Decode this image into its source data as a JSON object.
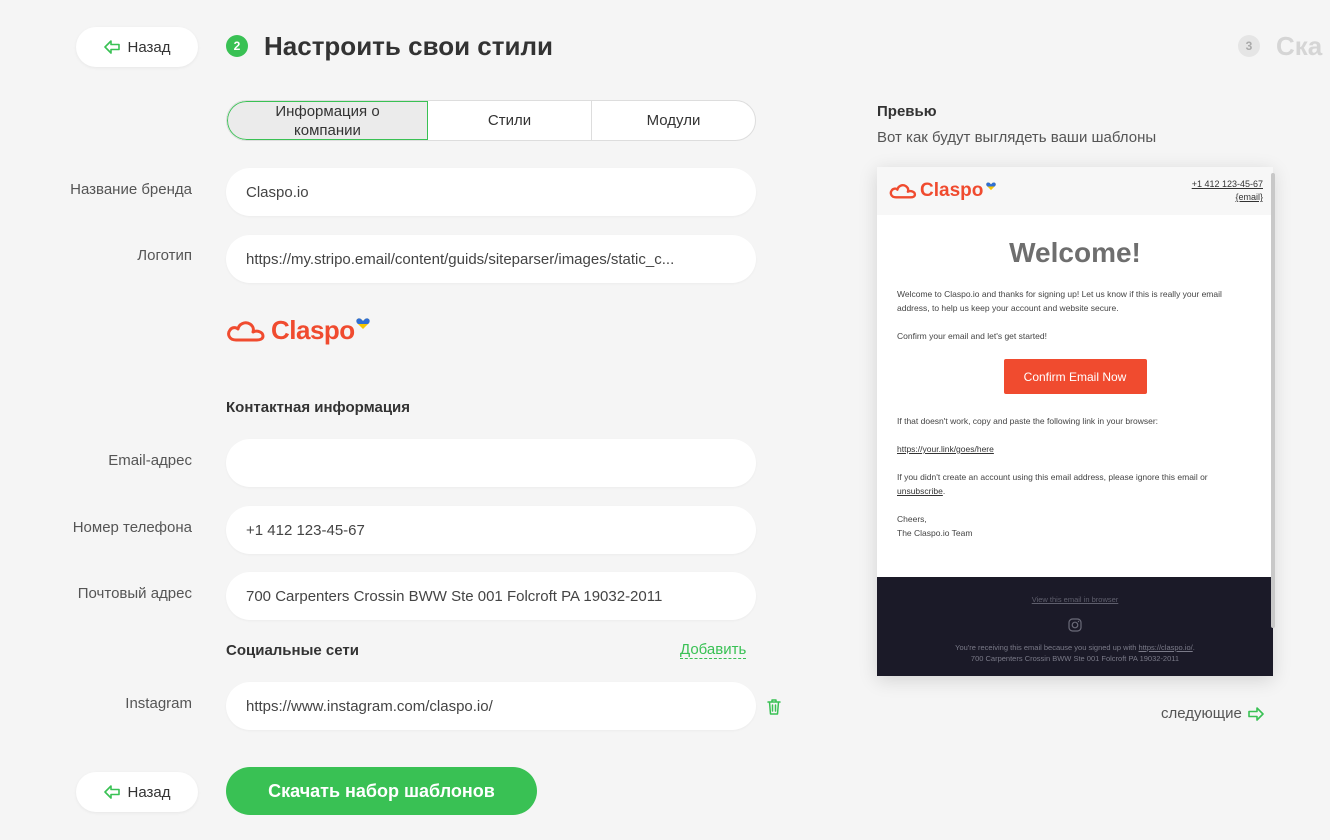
{
  "nav": {
    "back_label": "Назад",
    "next_label": "следующие"
  },
  "step2": {
    "number": "2",
    "title": "Настроить свои стили"
  },
  "step3": {
    "number": "3",
    "title": "Ска"
  },
  "tabs": [
    {
      "label": "Информация о компании",
      "active": true
    },
    {
      "label": "Стили",
      "active": false
    },
    {
      "label": "Модули",
      "active": false
    }
  ],
  "form": {
    "brand_label": "Название бренда",
    "brand_value": "Claspo.io",
    "logo_label": "Логотип",
    "logo_value": "https://my.stripo.email/content/guids/siteparser/images/static_c...",
    "logo_text": "Claspo",
    "contact_heading": "Контактная информация",
    "email_label": "Email-адрес",
    "email_value": "",
    "phone_label": "Номер телефона",
    "phone_value": "+1 412 123-45-67",
    "address_label": "Почтовый адрес",
    "address_value": "700 Carpenters Crossin BWW Ste 001 Folcroft PA 19032-2011",
    "social_heading": "Социальные сети",
    "add_label": "Добавить",
    "instagram_label": "Instagram",
    "instagram_value": "https://www.instagram.com/claspo.io/"
  },
  "download_label": "Скачать набор шаблонов",
  "preview": {
    "title": "Превью",
    "subtitle": "Вот как будут выглядеть ваши шаблоны",
    "logo_text": "Claspo",
    "phone": "+1 412 123-45-67",
    "email": "{email}",
    "heading": "Welcome!",
    "p1": "Welcome to Claspo.io and thanks for signing up! Let us know if this is really your email address, to help us keep your account and website secure.",
    "p2": "Confirm your email and let's get started!",
    "cta": "Confirm Email Now",
    "p3": "If that doesn't work, copy and paste the following link in your browser:",
    "link": "https://your.link/goes/here",
    "p4_a": "If you didn't create an account using this email address, please ignore this email or ",
    "p4_link": "unsubscribe",
    "p4_b": ".",
    "signoff_1": "Cheers,",
    "signoff_2": "The Claspo.io Team",
    "footer_view": "View this email in browser",
    "footer_line1_a": "You're receiving this email because you signed up with ",
    "footer_line1_link": "https://claspo.io/",
    "footer_line1_b": ".",
    "footer_line2": "700 Carpenters Crossin BWW Ste 001 Folcroft PA 19032-2011"
  },
  "colors": {
    "accent": "#39c154",
    "brand": "#f04b2f",
    "footer_bg": "#1b1a28"
  }
}
